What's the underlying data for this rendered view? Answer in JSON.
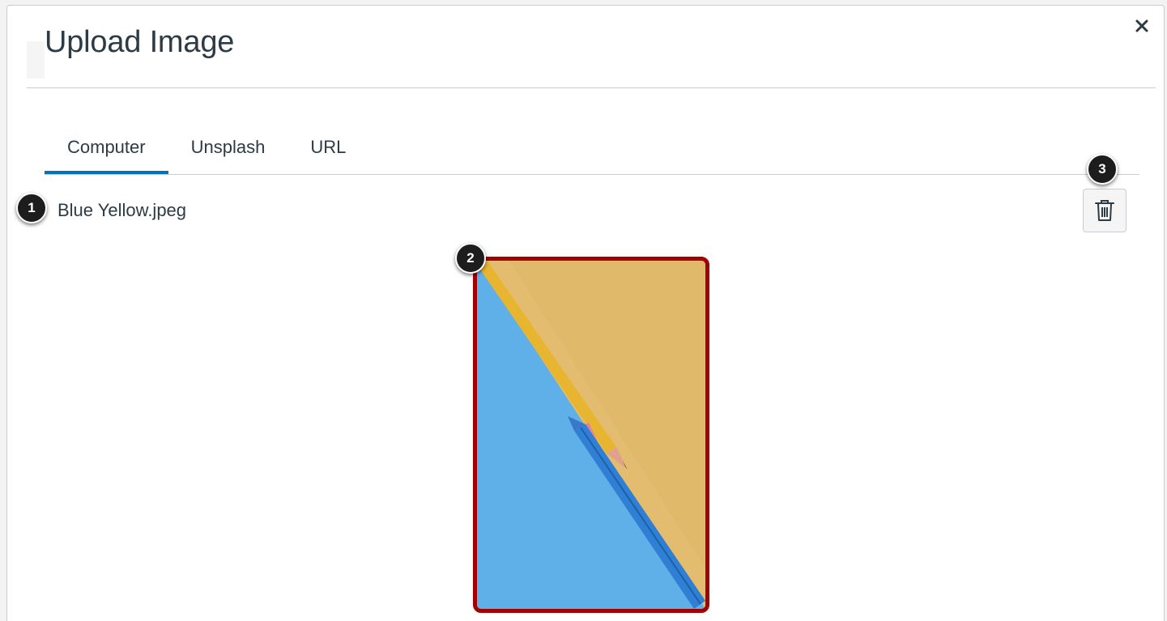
{
  "dialog": {
    "title": "Upload Image",
    "close_label": "×"
  },
  "tabs": [
    {
      "label": "Computer",
      "selected": true
    },
    {
      "label": "Unsplash",
      "selected": false
    },
    {
      "label": "URL",
      "selected": false
    }
  ],
  "file": {
    "name": "Blue Yellow.jpeg"
  },
  "callouts": [
    "1",
    "2",
    "3"
  ],
  "icons": {
    "close": "close-icon",
    "delete": "trash-icon",
    "preview": "image-preview"
  },
  "colors": {
    "accent": "#0374b5",
    "highlight_border": "#a40000",
    "text": "#2d3b45",
    "preview_blue": "#5fb0e8",
    "preview_yellow": "#e3bc6f"
  }
}
